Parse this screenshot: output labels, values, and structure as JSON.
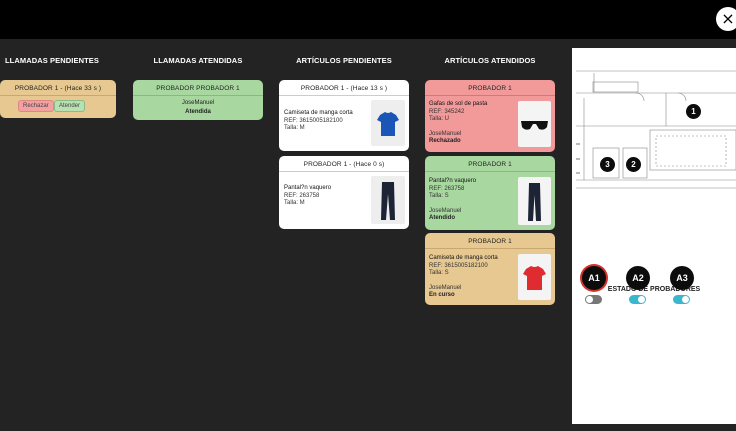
{
  "close_label": "×",
  "columns": {
    "pending_calls": "LLAMADAS PENDIENTES",
    "attended_calls": "LLAMADAS ATENDIDAS",
    "pending_items": "ARTÍCULOS PENDIENTES",
    "attended_items": "ARTÍCULOS ATENDIDOS"
  },
  "pending_call": {
    "header": "PROBADOR 1 - (Hace 33 s )",
    "reject_label": "Rechazar",
    "attend_label": "Atender"
  },
  "attended_call": {
    "header": "PROBADOR PROBADOR 1",
    "user": "JoseManuel",
    "status": "Atendida"
  },
  "pending_items": [
    {
      "header": "PROBADOR 1 - (Hace 13 s )",
      "name": "Camiseta de manga corta",
      "ref": "REF: 3615005182100",
      "size": "Talla: M",
      "icon": "blue-tshirt-icon"
    },
    {
      "header": "PROBADOR 1 - (Hace 0 s)",
      "name": "Pantal?n vaquero",
      "ref": "REF: 263758",
      "size": "Talla: M",
      "icon": "jeans-icon"
    }
  ],
  "attended_items": [
    {
      "header": "PROBADOR 1",
      "name": "Gafas de sol de pasta",
      "ref": "REF: 345242",
      "size": "Talla: U",
      "user": "JoseManuel",
      "status": "Rechazado",
      "icon": "sunglasses-icon",
      "color": "#f2999a"
    },
    {
      "header": "PROBADOR 1",
      "name": "Pantal?n vaquero",
      "ref": "REF: 263758",
      "size": "Talla: S",
      "user": "JoseManuel",
      "status": "Atendido",
      "icon": "jeans-icon",
      "color": "#a8d8a0"
    },
    {
      "header": "PROBADOR 1",
      "name": "Camiseta de manga corta",
      "ref": "REF: 3615005182100",
      "size": "Talla: S",
      "user": "JoseManuel",
      "status": "En curso",
      "icon": "red-tshirt-icon",
      "color": "#e6c890"
    }
  ],
  "floor_plan": {
    "markers": [
      "1",
      "2",
      "3"
    ]
  },
  "fitting_rooms": {
    "title": "ESTADO DE PROBADORES",
    "rooms": [
      {
        "label": "A1",
        "active": true,
        "toggle_on": false
      },
      {
        "label": "A2",
        "active": false,
        "toggle_on": true
      },
      {
        "label": "A3",
        "active": false,
        "toggle_on": true
      }
    ]
  }
}
